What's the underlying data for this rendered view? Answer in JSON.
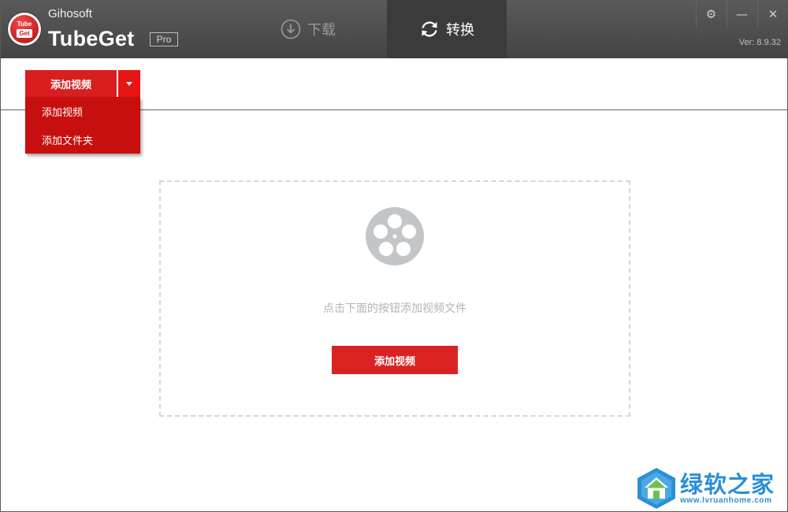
{
  "app": {
    "company": "Gihosoft",
    "product": "TubeGet",
    "edition": "Pro",
    "version": "Ver: 8.9.32",
    "logo_text_top": "Tube",
    "logo_text_bottom": "Get"
  },
  "tabs": [
    {
      "label": "下载",
      "icon": "download-icon",
      "active": false
    },
    {
      "label": "转换",
      "icon": "convert-icon",
      "active": true
    }
  ],
  "window_controls": {
    "settings_icon": "⚙",
    "minimize_icon": "—",
    "close_icon": "✕"
  },
  "toolbar": {
    "add_video_label": "添加视频"
  },
  "dropdown": {
    "items": [
      {
        "label": "添加视频"
      },
      {
        "label": "添加文件夹"
      }
    ]
  },
  "dropzone": {
    "hint": "点击下面的按钮添加视频文件",
    "button_label": "添加视频"
  },
  "watermark": {
    "title": "绿软之家",
    "url": "www.lvruanhome.com"
  },
  "colors": {
    "accent": "#d81e1e",
    "titlebar": "#4f4f4f",
    "active_tab": "#3b3b3b",
    "watermark": "#2a8fd4"
  }
}
